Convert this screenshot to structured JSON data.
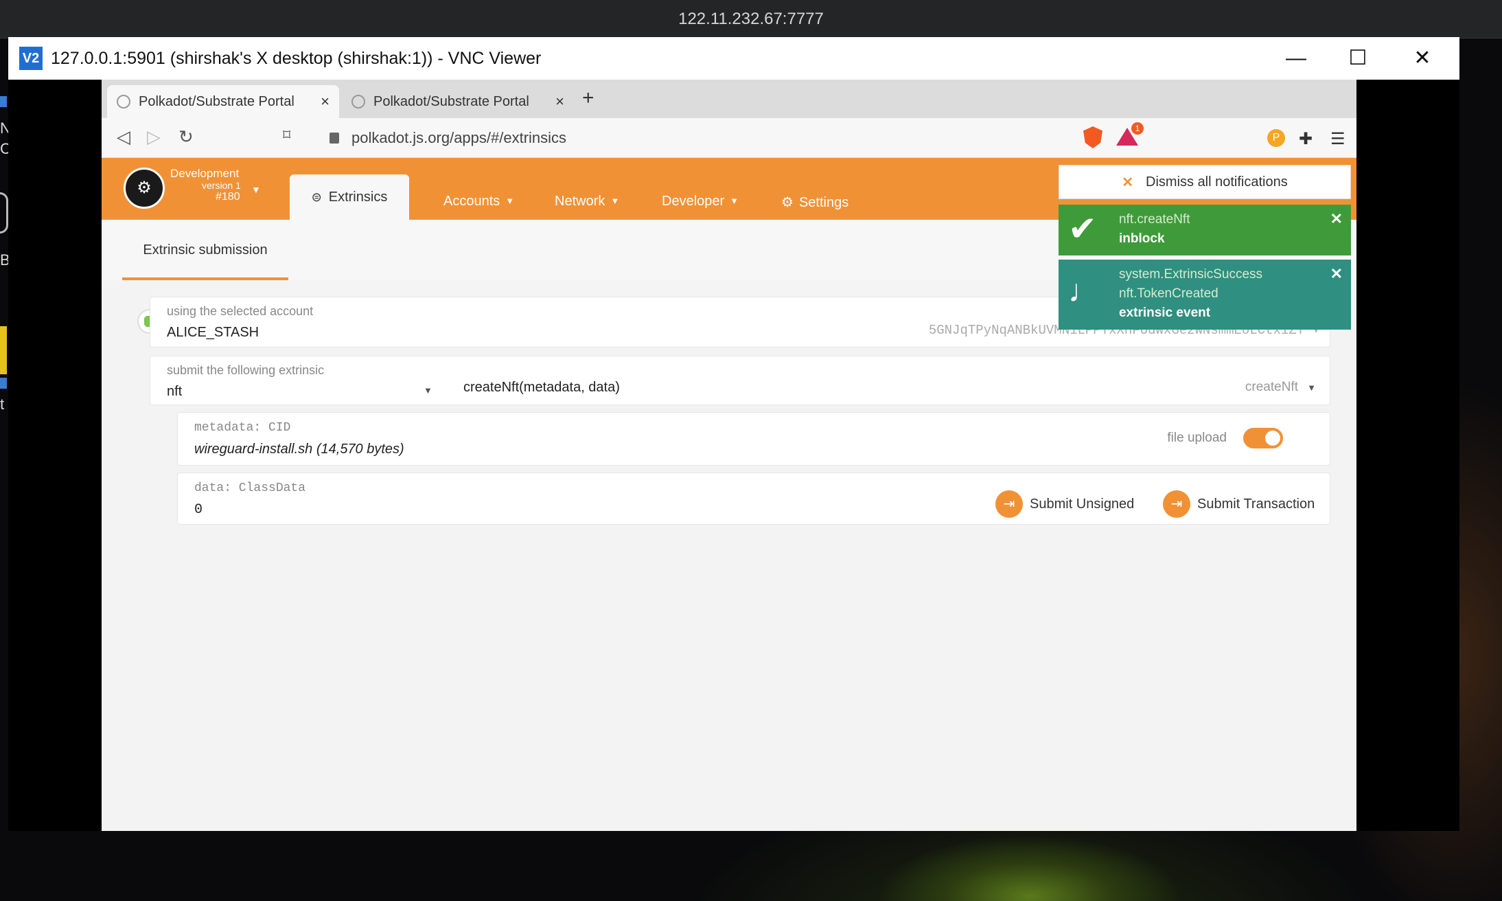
{
  "desktop": {
    "title": "122.11.232.67:7777",
    "left_glyphs": [
      "N",
      "C",
      "B",
      "t"
    ]
  },
  "vnc": {
    "logo": "V2",
    "title": "127.0.0.1:5901 (shirshak's X desktop (shirshak:1)) - VNC Viewer",
    "controls": {
      "minimize": "—",
      "maximize": "☐",
      "close": "✕"
    }
  },
  "browser": {
    "tabs": [
      {
        "label": "Polkadot/Substrate Portal",
        "close": "×"
      },
      {
        "label": "Polkadot/Substrate Portal",
        "close": "×"
      }
    ],
    "new_tab": "+",
    "url": "polkadot.js.org/apps/#/extrinsics",
    "badge_count": "1",
    "icons": [
      "back-icon",
      "forward-icon",
      "reload-icon",
      "bookmark-icon",
      "lock-icon",
      "brave-shield-icon",
      "brave-rewards-icon",
      "extension-p-icon",
      "puzzle-icon",
      "menu-icon"
    ]
  },
  "app": {
    "chain": {
      "name": "Development",
      "version": "version 1",
      "block": "#180"
    },
    "nav": {
      "active": "Extrinsics",
      "items": [
        "Accounts",
        "Network",
        "Developer",
        "Settings"
      ]
    },
    "subnav": {
      "tab": "Extrinsic submission"
    },
    "account": {
      "label": "using the selected account",
      "name": "ALICE_STASH",
      "address": "5GNJqTPyNqANBkUVMN1LPPTxXnFUdWxGe2WNsmmEoLCtxiZT ▾"
    },
    "extrinsic": {
      "label": "submit the following extrinsic",
      "module": "nft",
      "call": "createNft(metadata, data)",
      "method": "createNft"
    },
    "params": {
      "metadata_label": "metadata: CID",
      "metadata_value": "wireguard-install.sh (14,570 bytes)",
      "file_upload_label": "file upload",
      "data_label": "data: ClassData",
      "data_value": "0"
    },
    "actions": {
      "unsigned": "Submit Unsigned",
      "transaction": "Submit Transaction"
    }
  },
  "notifications": {
    "dismiss": "Dismiss all notifications",
    "items": [
      {
        "line1": "nft.createNft",
        "line2": "inblock",
        "color": "#3f9b3a"
      },
      {
        "line1": "system.ExtrinsicSuccess",
        "line2": "nft.TokenCreated",
        "line3": "extrinsic event",
        "color": "#2f8f80"
      }
    ]
  },
  "colors": {
    "accent": "#f19135",
    "success": "#3f9b3a",
    "event": "#2f8f80"
  }
}
